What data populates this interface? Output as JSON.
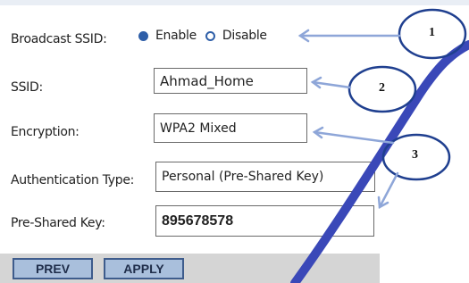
{
  "form": {
    "broadcast_label": "Broadcast SSID:",
    "enable_label": "Enable",
    "disable_label": "Disable",
    "broadcast_value": "Enable",
    "ssid_label": "SSID:",
    "ssid_value": "Ahmad_Home",
    "encryption_label": "Encryption:",
    "encryption_value": "WPA2 Mixed",
    "auth_label": "Authentication Type:",
    "auth_value": "Personal (Pre-Shared Key)",
    "psk_label": "Pre-Shared Key:",
    "psk_value": "895678578"
  },
  "buttons": {
    "prev": "PREV",
    "apply": "APPLY"
  },
  "callouts": [
    "1",
    "2",
    "3"
  ],
  "colors": {
    "accent": "#2f5fa8",
    "button_fill": "#a9bfdc",
    "button_border": "#3e5c8c",
    "button_bar": "#d5d5d5",
    "arrow": "#8ea6d8",
    "swoosh": "#3a48b8"
  }
}
